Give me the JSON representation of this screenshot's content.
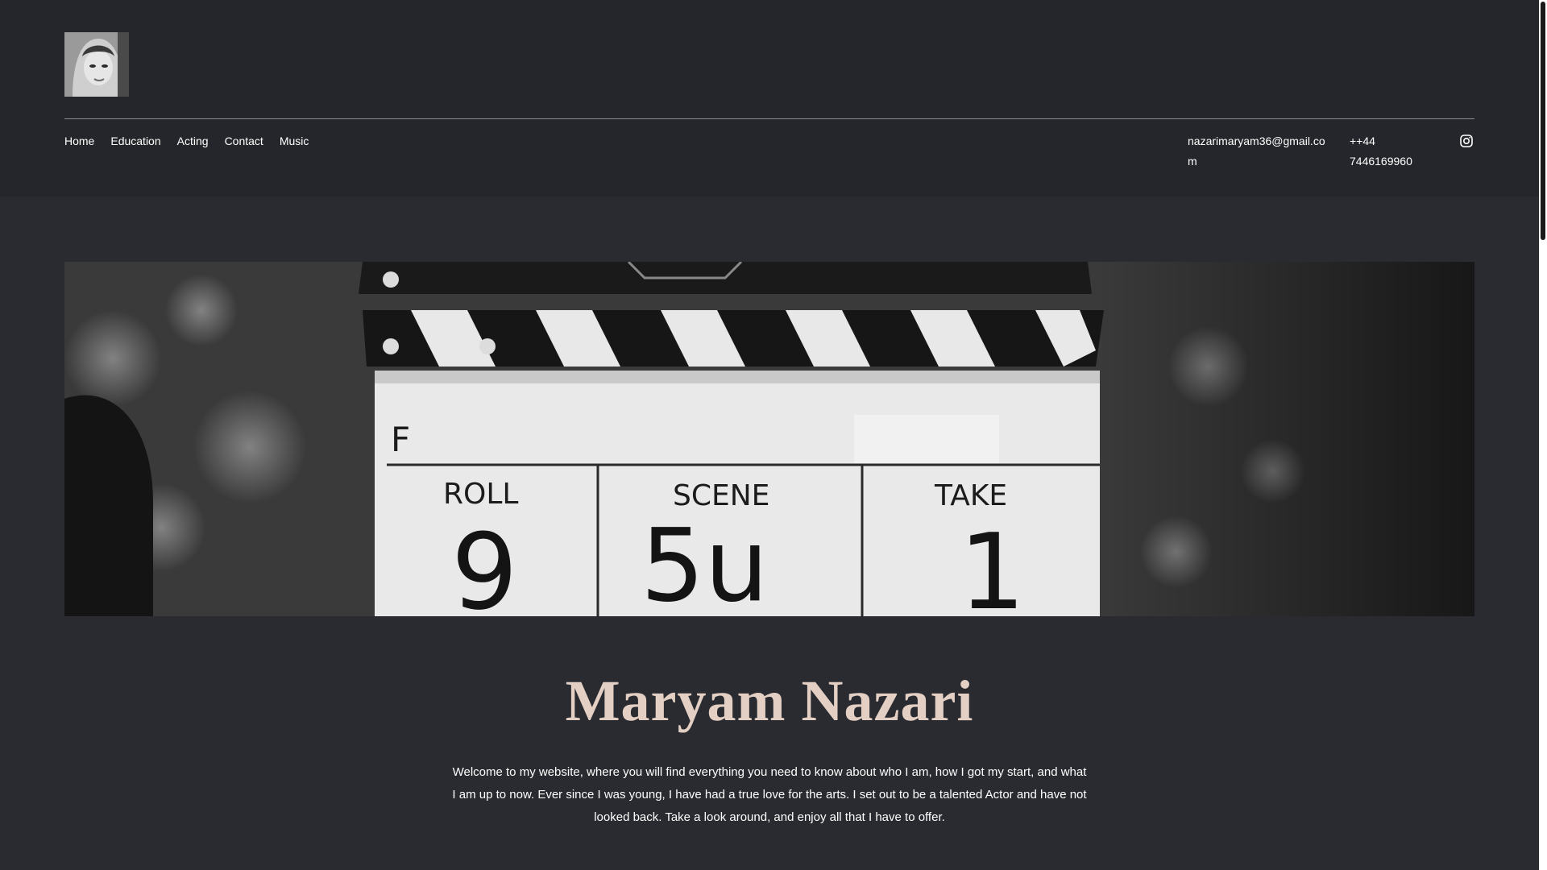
{
  "header": {
    "nav": [
      "Home",
      "Education",
      "Acting",
      "Contact",
      "Music"
    ],
    "email": "nazarimaryam36@gmail.com",
    "phone": "++44 7446169960"
  },
  "hero": {
    "slate": {
      "letter": "F",
      "roll_label": "ROLL",
      "roll_value": "9",
      "scene_label": "SCENE",
      "scene_value": "5u",
      "take_label": "TAKE",
      "take_value": "1"
    }
  },
  "main": {
    "name": "Maryam Nazari",
    "intro": "Welcome to my website, where you will find everything you need to know about who I am, how I got my start, and what I am up to now. Ever since I was young, I have had a true love for the arts. I set out to be a talented Actor and have not looked back. Take a look around, and enjoy all that I have to offer."
  },
  "icons": {
    "instagram": "instagram-icon",
    "avatar": "profile-photo"
  },
  "colors": {
    "background": "#25262b",
    "accent_name": "#e3cfc3",
    "divider": "#8c8d91"
  }
}
